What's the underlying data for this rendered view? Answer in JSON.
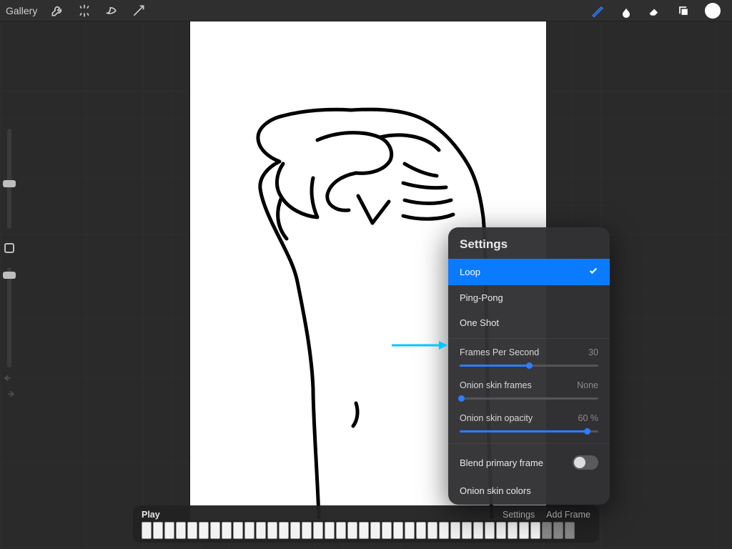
{
  "topbar": {
    "gallery": "Gallery"
  },
  "settings": {
    "title": "Settings",
    "modes": {
      "loop": "Loop",
      "pingpong": "Ping-Pong",
      "oneshot": "One Shot"
    },
    "fps": {
      "label": "Frames Per Second",
      "value": "30",
      "fill_pct": 50
    },
    "onion_frames": {
      "label": "Onion skin frames",
      "value": "None",
      "fill_pct": 0
    },
    "onion_opacity": {
      "label": "Onion skin opacity",
      "value": "60 %",
      "fill_pct": 92
    },
    "blend": "Blend primary frame",
    "onion_colors": "Onion skin colors"
  },
  "timeline": {
    "play": "Play",
    "settings": "Settings",
    "add_frame": "Add Frame",
    "frame_count": 38
  },
  "colors": {
    "accent": "#0a7bff",
    "brush": "#2d7dff",
    "arrow": "#00c8ff"
  }
}
